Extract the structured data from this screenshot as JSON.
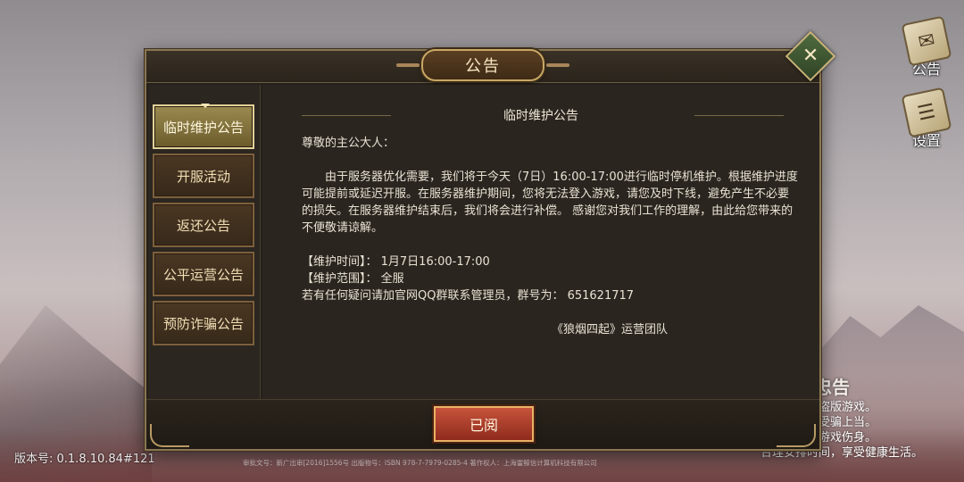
{
  "dialog": {
    "title": "公告",
    "close_icon": "close-icon",
    "confirm_label": "已阅"
  },
  "tabs": [
    {
      "label": "临时维护公告",
      "active": true
    },
    {
      "label": "开服活动",
      "active": false
    },
    {
      "label": "返还公告",
      "active": false
    },
    {
      "label": "公平运营公告",
      "active": false
    },
    {
      "label": "预防诈骗公告",
      "active": false
    }
  ],
  "notice": {
    "title": "临时维护公告",
    "greeting": "尊敬的主公大人：",
    "body": "由于服务器优化需要，我们将于今天（7日）16:00-17:00进行临时停机维护。根据维护进度可能提前或延迟开服。在服务器维护期间，您将无法登入游戏，请您及时下线，避免产生不必要的损失。在服务器维护结束后，我们将会进行补偿。 感谢您对我们工作的理解，由此给您带来的不便敬请谅解。",
    "time_line": "【维护时间】：  1月7日16:00-17:00",
    "scope_line": "【维护范围】：  全服",
    "contact_line": "若有任何疑问请加官网QQ群联系管理员，群号为：  651621717",
    "signature": "《狼烟四起》运营团队"
  },
  "side_buttons": {
    "notice_label": "公告",
    "settings_label": "设置"
  },
  "health": {
    "title": "康游戏忠告",
    "lines": [
      "游戏，拒绝盗版游戏。",
      "保护，谨防受骗上当。",
      "益脑，沉迷游戏伤身。",
      "合理安排时间，享受健康生活。"
    ]
  },
  "version": "版本号: 0.1.8.10.84#121",
  "legal": "审批文号：新广出审[2016]1556号 出版物号：ISBN 978-7-7979-0285-4 著作权人：上海雷鲸信计算机科技有限公司",
  "colors": {
    "accent_gold": "#c9a866",
    "confirm_red": "#c7533b",
    "panel_dark": "#24201b"
  }
}
